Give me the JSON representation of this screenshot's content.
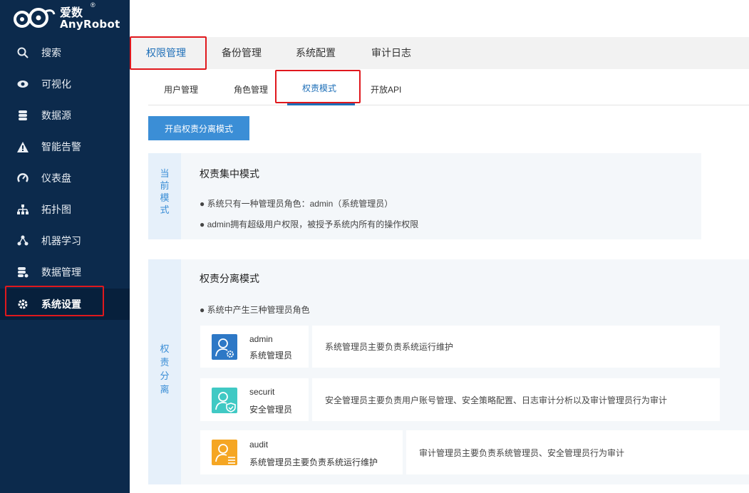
{
  "brand": {
    "name_cn": "爱数",
    "name_en": "AnyRobot",
    "reg": "®"
  },
  "sidebar": {
    "items": [
      {
        "label": "搜索",
        "icon": "search-icon"
      },
      {
        "label": "可视化",
        "icon": "eye-icon"
      },
      {
        "label": "数据源",
        "icon": "database-icon"
      },
      {
        "label": "智能告警",
        "icon": "alert-icon"
      },
      {
        "label": "仪表盘",
        "icon": "dashboard-icon"
      },
      {
        "label": "拓扑图",
        "icon": "topology-icon"
      },
      {
        "label": "机器学习",
        "icon": "machine-learning-icon"
      },
      {
        "label": "数据管理",
        "icon": "data-management-icon"
      },
      {
        "label": "系统设置",
        "icon": "gear-icon",
        "active": true
      }
    ]
  },
  "top_tabs": [
    "权限管理",
    "备份管理",
    "系统配置",
    "审计日志"
  ],
  "sub_tabs": [
    "用户管理",
    "角色管理",
    "权责模式",
    "开放API"
  ],
  "toggle_button": "开启权责分离模式",
  "current_mode": {
    "side_label": "当前模式",
    "title": "权责集中模式",
    "bullets": [
      "● 系统只有一种管理员角色：admin（系统管理员）",
      "● admin拥有超级用户权限，被授予系统内所有的操作权限"
    ]
  },
  "separation_mode": {
    "side_label": "权责分离",
    "title": "权责分离模式",
    "bullet": "● 系统中产生三种管理员角色",
    "roles": [
      {
        "name": "admin",
        "title": "系统管理员",
        "desc": "系统管理员主要负责系统运行维护",
        "icon": "admin-user-gear-icon",
        "color": "#2d78c6"
      },
      {
        "name": "securit",
        "title": "安全管理员",
        "desc": "安全管理员主要负责用户账号管理、安全策略配置、日志审计分析以及审计管理员行为审计",
        "icon": "security-user-shield-icon",
        "color": "#40c9c4"
      },
      {
        "name": "audit",
        "title": "系统管理员主要负责系统运行维护",
        "desc": "审计管理员主要负责系统管理员、安全管理员行为审计",
        "icon": "audit-user-list-icon",
        "color": "#f5a623"
      }
    ]
  },
  "colors": {
    "sidebar_bg": "#0c2a4c",
    "accent": "#1e6fb8",
    "button": "#3b8ed6",
    "highlight": "#e0181d"
  }
}
